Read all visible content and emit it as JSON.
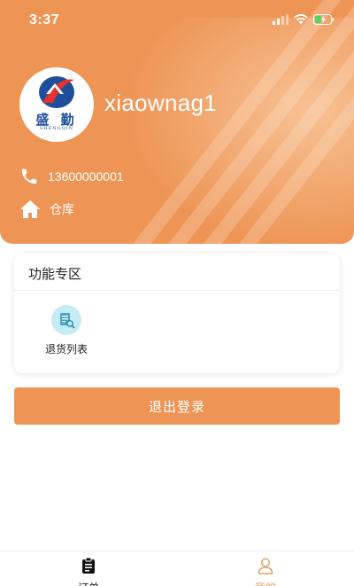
{
  "status_bar": {
    "time": "3:37"
  },
  "profile": {
    "logo_text": "盛 勤",
    "logo_sub": "SHENGQIN",
    "username": "xiaownag1",
    "phone": "13600000001",
    "location": "仓库"
  },
  "functions": {
    "title": "功能专区",
    "items": [
      {
        "label": "退货列表",
        "icon": "return-list-icon"
      }
    ]
  },
  "logout_label": "退出登录",
  "tabbar": {
    "items": [
      {
        "label": "订单",
        "icon": "clipboard-icon",
        "active": false
      },
      {
        "label": "我的",
        "icon": "person-icon",
        "active": true
      }
    ]
  },
  "colors": {
    "accent": "#ee9556",
    "tab_active": "#e0a26a",
    "tab_inactive": "#111111",
    "logo_blue": "#1f4f9a",
    "icon_bg": "#c4ecf4"
  }
}
